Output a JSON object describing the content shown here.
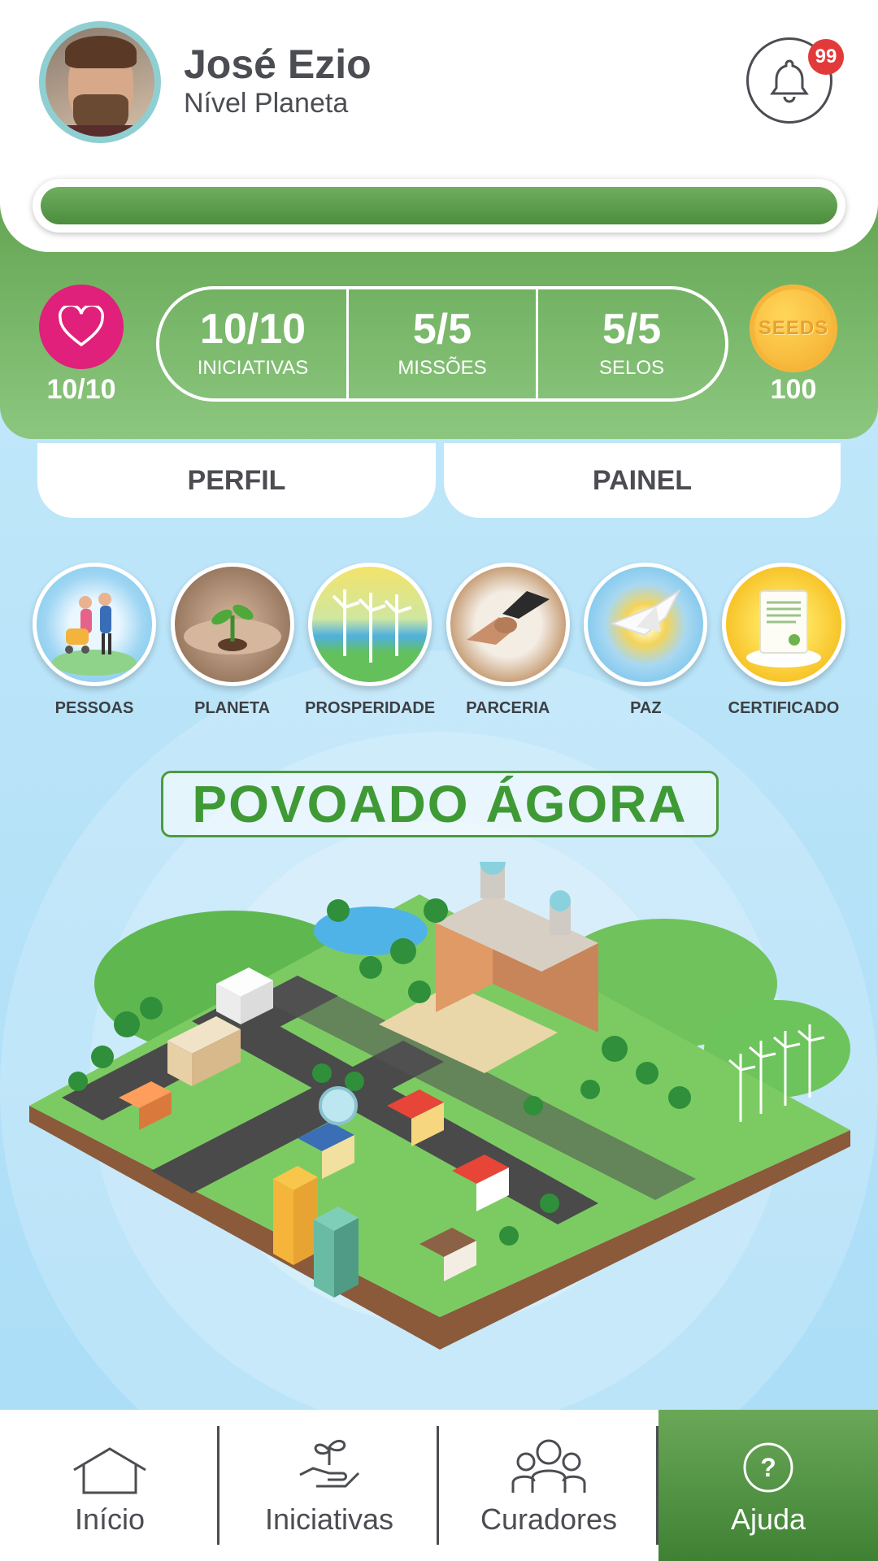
{
  "user": {
    "name": "José Ezio",
    "level": "Nível Planeta",
    "progress": 1.0
  },
  "notifications": {
    "count": "99"
  },
  "stats": {
    "lives": "10/10",
    "items": [
      {
        "value": "10/10",
        "label": "INICIATIVAS"
      },
      {
        "value": "5/5",
        "label": "MISSÕES"
      },
      {
        "value": "5/5",
        "label": "SELOS"
      }
    ],
    "coin_label": "SEEDS",
    "coins": "100"
  },
  "tabs": {
    "perfil": "PERFIL",
    "painel": "PAINEL"
  },
  "categories": [
    {
      "label": "PESSOAS"
    },
    {
      "label": "PLANETA"
    },
    {
      "label": "PROSPERIDADE"
    },
    {
      "label": "PARCERIA"
    },
    {
      "label": "PAZ"
    },
    {
      "label": "CERTIFICADO"
    }
  ],
  "banner": {
    "title": "POVOADO ÁGORA"
  },
  "nav": {
    "inicio": "Início",
    "iniciativas": "Iniciativas",
    "curadores": "Curadores",
    "ajuda": "Ajuda"
  },
  "colors": {
    "primary_green": "#4c8d3e",
    "heart_pink": "#e0207a",
    "badge_red": "#e23a3a",
    "coin_gold": "#f3a92a",
    "sky": "#b6e2f8"
  }
}
